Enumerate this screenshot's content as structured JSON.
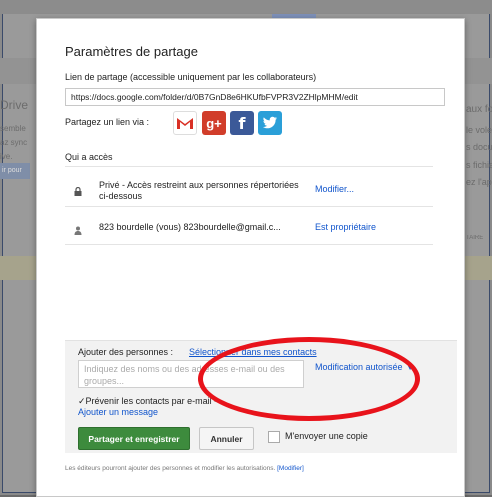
{
  "dialog": {
    "title": "Paramètres de partage",
    "link_label": "Lien de partage (accessible uniquement par les collaborateurs)",
    "link_value": "https://docs.google.com/folder/d/0B7GnD8e6HKUfbFVPR3V2ZHlpMHM/edit",
    "share_via": "Partagez un lien via :",
    "social_icons": [
      "gmail-icon",
      "google-plus-icon",
      "facebook-icon",
      "twitter-icon"
    ],
    "social_glyphs": {
      "gmail": "M",
      "gplus": "g+",
      "facebook": "f",
      "twitter": "t"
    },
    "access_heading": "Qui a accès",
    "access_rows": [
      {
        "icon": "lock-icon",
        "text": "Privé - Accès restreint aux personnes répertoriées ci-dessous",
        "action": "Modifier..."
      },
      {
        "icon": "person-icon",
        "text": "823 bourdelle (vous)  823bourdelle@gmail.c...",
        "action": "Est propriétaire"
      }
    ],
    "add_people": {
      "label": "Ajouter des personnes :",
      "select_contacts": "Sélectionner dans mes contacts",
      "input_placeholder": "Indiquez des noms ou des adresses e-mail ou des groupes...",
      "permission": "Modification autorisée",
      "notify_check": "✓",
      "notify_text": "Prévenir les contacts par e-mail - ",
      "notify_link": "Ajouter un message",
      "save_button": "Partager et enregistrer",
      "cancel_button": "Annuler",
      "copy_label": "M'envoyer une copie"
    },
    "footer_text": "Les éditeurs pourront ajouter des personnes et modifier les autorisations.",
    "footer_link": "[Modifier]"
  },
  "background": {
    "left_title": "Drive",
    "left_lines": [
      "semble",
      "az sync",
      "ive."
    ],
    "left_button": "ir pour",
    "right_lines": [
      "aux fo",
      "le volet",
      "s docum",
      "s fichie",
      "ez l'app"
    ],
    "right_caps": "TAIRE"
  },
  "colors": {
    "accent_link": "#1155cc",
    "primary_button": "#3d8b3d",
    "annotation": "#e8131b"
  }
}
